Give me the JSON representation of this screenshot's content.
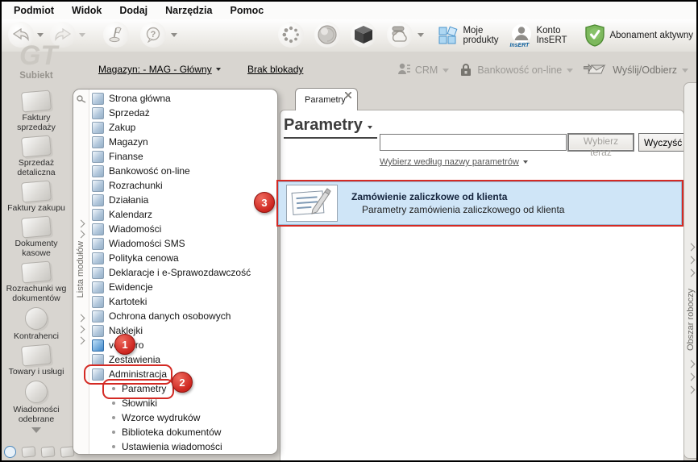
{
  "menu": {
    "items": [
      "Podmiot",
      "Widok",
      "Dodaj",
      "Narzędzia",
      "Pomoc"
    ]
  },
  "toolbar": {
    "moje_produkty": "Moje produkty",
    "konto_insert": "Konto InsERT",
    "insert_logo": "InsERT",
    "abonament": "Abonament aktywny"
  },
  "row2": {
    "magazyn": "Magazyn: - MAG - Główny",
    "brak_blokady": "Brak blokady",
    "crm": "CRM",
    "bankowosc": "Bankowość on-line",
    "wyslij": "Wyślij/Odbierz"
  },
  "sidebar": {
    "logo_gt": "GT",
    "logo_subiekt": "Subiekt",
    "items": [
      "Faktury sprzedaży",
      "Sprzedaż detaliczna",
      "Faktury zakupu",
      "Dokumenty kasowe",
      "Rozrachunki wg dokumentów",
      "Kontrahenci",
      "Towary i usługi",
      "Wiadomości odebrane"
    ]
  },
  "tree": {
    "vertical_label": "Lista modułów",
    "items": [
      "Strona główna",
      "Sprzedaż",
      "Zakup",
      "Magazyn",
      "Finanse",
      "Bankowość on-line",
      "Rozrachunki",
      "Działania",
      "Kalendarz",
      "Wiadomości",
      "Wiadomości SMS",
      "Polityka cenowa",
      "Deklaracje i e-Sprawozdawczość",
      "Ewidencje",
      "Kartoteki",
      "Ochrona danych osobowych",
      "Naklejki",
      "vendero",
      "Zestawienia",
      "Administracja"
    ],
    "children": [
      "Parametry",
      "Słowniki",
      "Wzorce wydruków",
      "Biblioteka dokumentów",
      "Ustawienia wiadomości"
    ]
  },
  "main": {
    "tab_label": "Parametry",
    "title": "Parametry",
    "search_value": "",
    "select_button": "Wybierz teraz",
    "clear_button": "Wyczyść",
    "filter_link": "Wybierz według nazwy parametrów",
    "card": {
      "title": "Zamówienie zaliczkowe od klienta",
      "subtitle": "Parametry zamówienia zaliczkowego od klienta"
    }
  },
  "right_strip": {
    "vertical_label": "Obszar roboczy"
  },
  "annotations": {
    "step1": "1",
    "step2": "2",
    "step3": "3"
  },
  "colors": {
    "annotation_red": "#d42a24",
    "selection_blue": "#cfe5f7",
    "abonament_green": "#5da23c",
    "insert_blue": "#1464a0"
  }
}
